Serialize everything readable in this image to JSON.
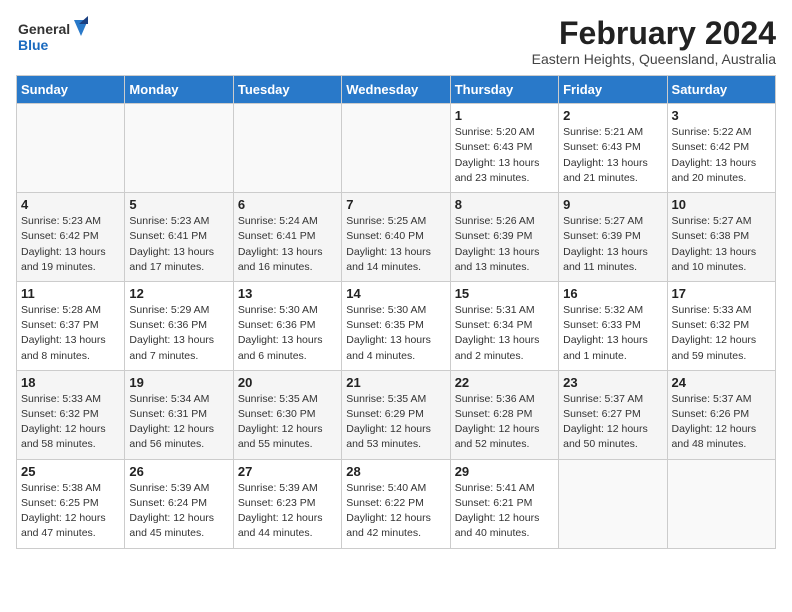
{
  "header": {
    "logo_line1": "General",
    "logo_line2": "Blue",
    "month_year": "February 2024",
    "location": "Eastern Heights, Queensland, Australia"
  },
  "weekdays": [
    "Sunday",
    "Monday",
    "Tuesday",
    "Wednesday",
    "Thursday",
    "Friday",
    "Saturday"
  ],
  "weeks": [
    [
      {
        "day": "",
        "info": ""
      },
      {
        "day": "",
        "info": ""
      },
      {
        "day": "",
        "info": ""
      },
      {
        "day": "",
        "info": ""
      },
      {
        "day": "1",
        "info": "Sunrise: 5:20 AM\nSunset: 6:43 PM\nDaylight: 13 hours\nand 23 minutes."
      },
      {
        "day": "2",
        "info": "Sunrise: 5:21 AM\nSunset: 6:43 PM\nDaylight: 13 hours\nand 21 minutes."
      },
      {
        "day": "3",
        "info": "Sunrise: 5:22 AM\nSunset: 6:42 PM\nDaylight: 13 hours\nand 20 minutes."
      }
    ],
    [
      {
        "day": "4",
        "info": "Sunrise: 5:23 AM\nSunset: 6:42 PM\nDaylight: 13 hours\nand 19 minutes."
      },
      {
        "day": "5",
        "info": "Sunrise: 5:23 AM\nSunset: 6:41 PM\nDaylight: 13 hours\nand 17 minutes."
      },
      {
        "day": "6",
        "info": "Sunrise: 5:24 AM\nSunset: 6:41 PM\nDaylight: 13 hours\nand 16 minutes."
      },
      {
        "day": "7",
        "info": "Sunrise: 5:25 AM\nSunset: 6:40 PM\nDaylight: 13 hours\nand 14 minutes."
      },
      {
        "day": "8",
        "info": "Sunrise: 5:26 AM\nSunset: 6:39 PM\nDaylight: 13 hours\nand 13 minutes."
      },
      {
        "day": "9",
        "info": "Sunrise: 5:27 AM\nSunset: 6:39 PM\nDaylight: 13 hours\nand 11 minutes."
      },
      {
        "day": "10",
        "info": "Sunrise: 5:27 AM\nSunset: 6:38 PM\nDaylight: 13 hours\nand 10 minutes."
      }
    ],
    [
      {
        "day": "11",
        "info": "Sunrise: 5:28 AM\nSunset: 6:37 PM\nDaylight: 13 hours\nand 8 minutes."
      },
      {
        "day": "12",
        "info": "Sunrise: 5:29 AM\nSunset: 6:36 PM\nDaylight: 13 hours\nand 7 minutes."
      },
      {
        "day": "13",
        "info": "Sunrise: 5:30 AM\nSunset: 6:36 PM\nDaylight: 13 hours\nand 6 minutes."
      },
      {
        "day": "14",
        "info": "Sunrise: 5:30 AM\nSunset: 6:35 PM\nDaylight: 13 hours\nand 4 minutes."
      },
      {
        "day": "15",
        "info": "Sunrise: 5:31 AM\nSunset: 6:34 PM\nDaylight: 13 hours\nand 2 minutes."
      },
      {
        "day": "16",
        "info": "Sunrise: 5:32 AM\nSunset: 6:33 PM\nDaylight: 13 hours\nand 1 minute."
      },
      {
        "day": "17",
        "info": "Sunrise: 5:33 AM\nSunset: 6:32 PM\nDaylight: 12 hours\nand 59 minutes."
      }
    ],
    [
      {
        "day": "18",
        "info": "Sunrise: 5:33 AM\nSunset: 6:32 PM\nDaylight: 12 hours\nand 58 minutes."
      },
      {
        "day": "19",
        "info": "Sunrise: 5:34 AM\nSunset: 6:31 PM\nDaylight: 12 hours\nand 56 minutes."
      },
      {
        "day": "20",
        "info": "Sunrise: 5:35 AM\nSunset: 6:30 PM\nDaylight: 12 hours\nand 55 minutes."
      },
      {
        "day": "21",
        "info": "Sunrise: 5:35 AM\nSunset: 6:29 PM\nDaylight: 12 hours\nand 53 minutes."
      },
      {
        "day": "22",
        "info": "Sunrise: 5:36 AM\nSunset: 6:28 PM\nDaylight: 12 hours\nand 52 minutes."
      },
      {
        "day": "23",
        "info": "Sunrise: 5:37 AM\nSunset: 6:27 PM\nDaylight: 12 hours\nand 50 minutes."
      },
      {
        "day": "24",
        "info": "Sunrise: 5:37 AM\nSunset: 6:26 PM\nDaylight: 12 hours\nand 48 minutes."
      }
    ],
    [
      {
        "day": "25",
        "info": "Sunrise: 5:38 AM\nSunset: 6:25 PM\nDaylight: 12 hours\nand 47 minutes."
      },
      {
        "day": "26",
        "info": "Sunrise: 5:39 AM\nSunset: 6:24 PM\nDaylight: 12 hours\nand 45 minutes."
      },
      {
        "day": "27",
        "info": "Sunrise: 5:39 AM\nSunset: 6:23 PM\nDaylight: 12 hours\nand 44 minutes."
      },
      {
        "day": "28",
        "info": "Sunrise: 5:40 AM\nSunset: 6:22 PM\nDaylight: 12 hours\nand 42 minutes."
      },
      {
        "day": "29",
        "info": "Sunrise: 5:41 AM\nSunset: 6:21 PM\nDaylight: 12 hours\nand 40 minutes."
      },
      {
        "day": "",
        "info": ""
      },
      {
        "day": "",
        "info": ""
      }
    ]
  ]
}
